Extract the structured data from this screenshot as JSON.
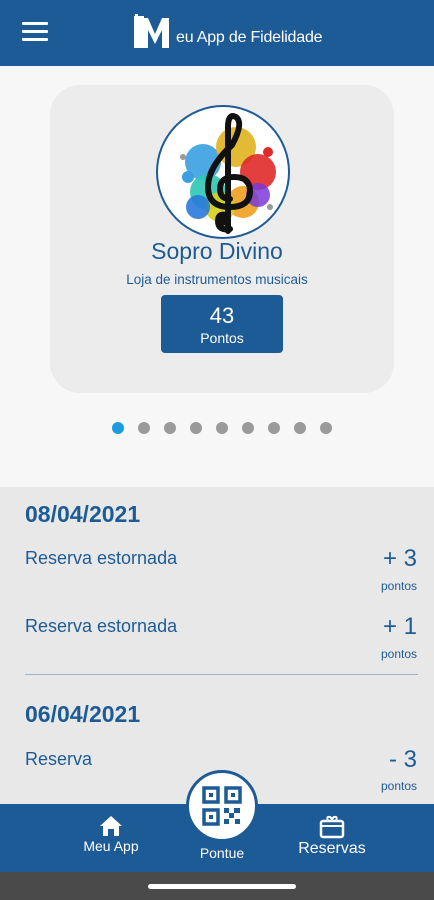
{
  "header": {
    "app_title": "eu App de Fidelidade",
    "menu_icon": "hamburger-menu-icon",
    "logo_icon": "meu-app-logo-icon"
  },
  "store": {
    "name": "Sopro Divino",
    "subtitle": "Loja de instrumentos musicais",
    "points": "43",
    "points_label": "Pontos",
    "logo_icon": "treble-clef-icon"
  },
  "carousel": {
    "page_count": 9,
    "active_index": 0
  },
  "history": {
    "groups": [
      {
        "date": "08/04/2021",
        "entries": [
          {
            "label": "Reserva estornada",
            "value": "+ 3",
            "unit": "pontos"
          },
          {
            "label": "Reserva estornada",
            "value": "+ 1",
            "unit": "pontos"
          }
        ]
      },
      {
        "date": "06/04/2021",
        "entries": [
          {
            "label": "Reserva",
            "value": "- 3",
            "unit": "pontos"
          }
        ]
      }
    ]
  },
  "bottom_nav": {
    "home_label": "Meu App",
    "scan_label": "Pontue",
    "reservations_label": "Reservas"
  },
  "colors": {
    "primary": "#1d5b96",
    "accent": "#1e9be0",
    "background": "#f7f7f7",
    "card": "#ececec"
  }
}
